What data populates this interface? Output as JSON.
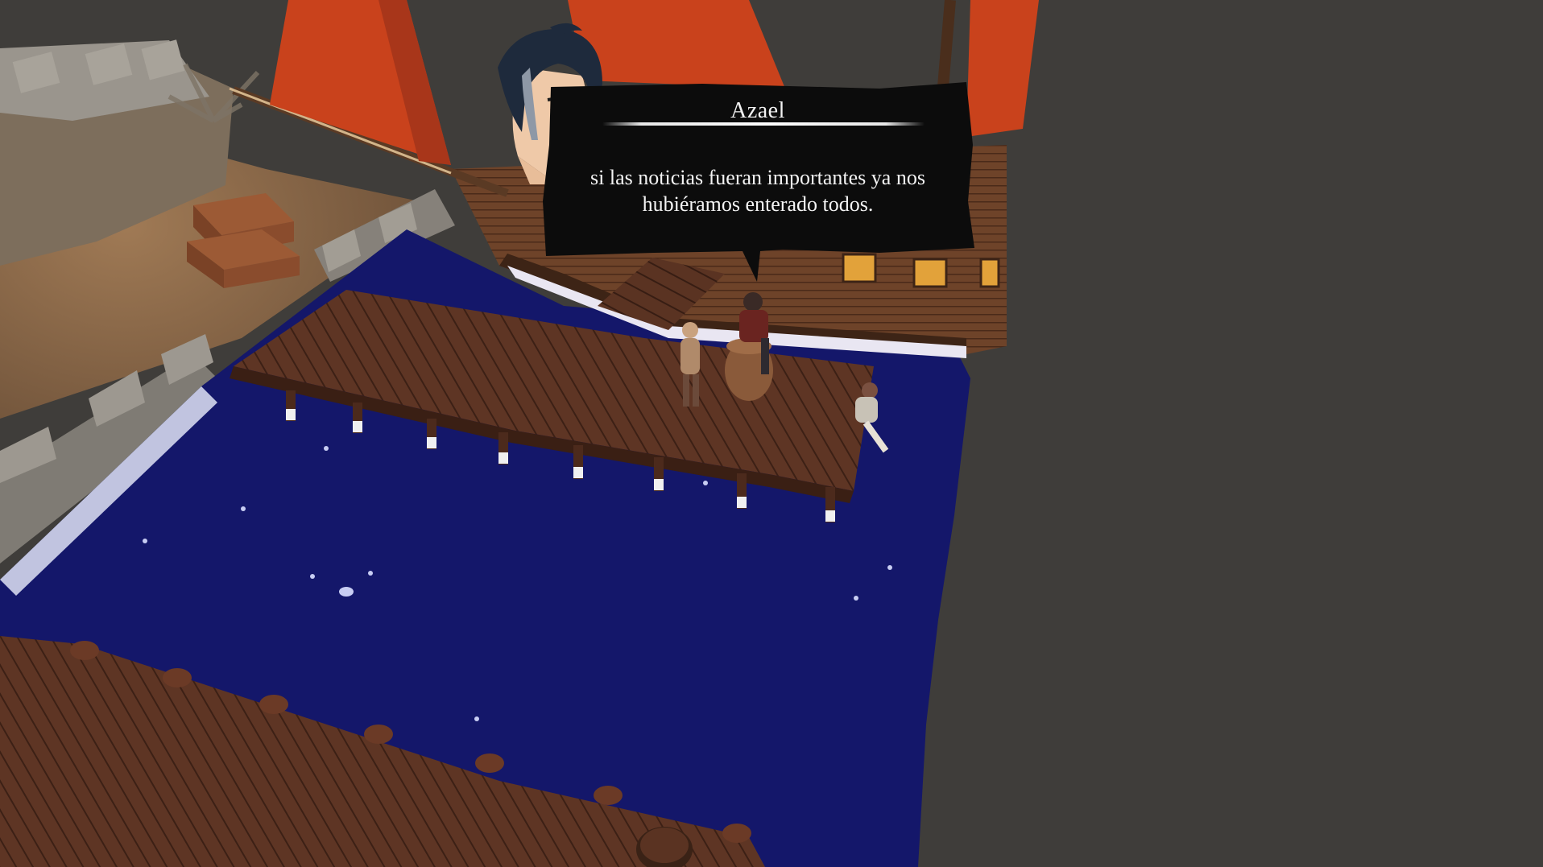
{
  "dialogue": {
    "speaker": "Azael",
    "text": "si las noticias fueran importantes ya nos hubiéramos enterado todos."
  },
  "colors": {
    "background": "#3f3d3a",
    "water": "#14176a",
    "dock_wood": "#5a3322",
    "sail": "#c9421c",
    "ship_hull": "#6b4026",
    "sand": "#8a6a4a",
    "stone_wall": "#8f8b84",
    "dialog_box": "#0c0c0c",
    "dialog_text": "#f4f4f4",
    "portrait_hair": "#1e2a3c"
  },
  "icons": {
    "portrait": "azael-portrait-icon"
  }
}
